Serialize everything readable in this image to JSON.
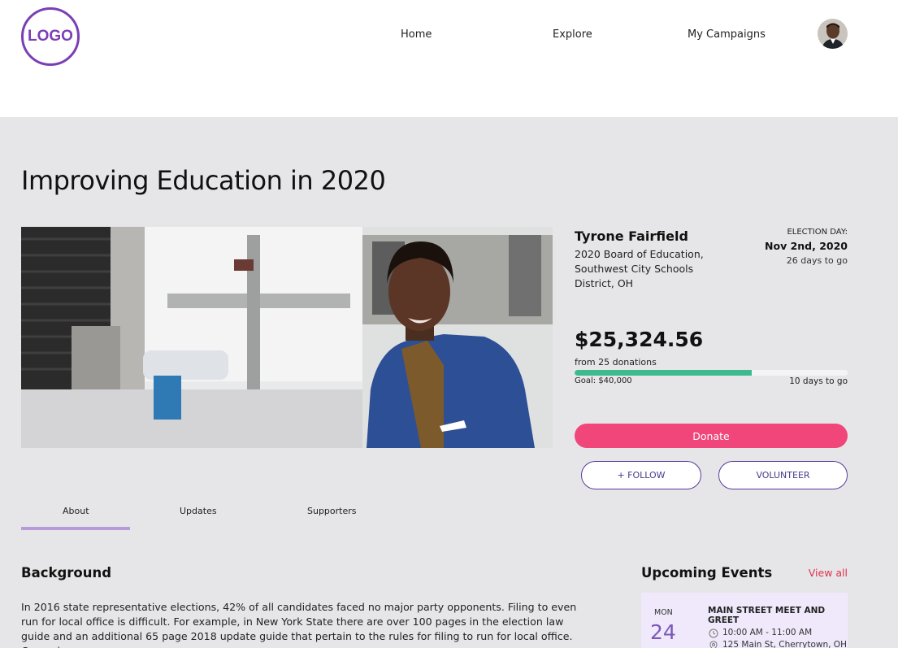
{
  "header": {
    "logo_text": "LOGO",
    "nav": [
      "Home",
      "Explore",
      "My Campaigns"
    ]
  },
  "campaign": {
    "title": "Improving Education in 2020",
    "candidate_name": "Tyrone Fairfield",
    "office": "2020 Board of Education, Southwest City Schools District, OH",
    "election_label": "ELECTION DAY:",
    "election_date": "Nov 2nd, 2020",
    "election_days_left": "26 days to go",
    "amount": "$25,324.56",
    "donations_text": "from 25 donations",
    "progress_fraction": 0.65,
    "goal_text": "Goal: $40,000",
    "goal_days_left": "10 days to go",
    "donate_label": "Donate",
    "follow_label": "+ FOLLOW",
    "volunteer_label": "VOLUNTEER"
  },
  "tabs": [
    "About",
    "Updates",
    "Supporters"
  ],
  "background": {
    "heading": "Background",
    "text": "In 2016 state representative elections, 42% of all candidates faced no major party opponents. Filing to even run for local office is difficult. For example, in New York State there are over 100 pages in the election law guide and an additional 65 page 2018 update guide that pertain to the rules for filing to run for local office. Campaign"
  },
  "events": {
    "heading": "Upcoming Events",
    "view_all": "View all",
    "items": [
      {
        "month": "MON",
        "day": "24",
        "title": "MAIN STREET MEET AND GREET",
        "time": "10:00 AM - 11:00 AM",
        "address": "125 Main St, Cherrytown, OH"
      }
    ]
  },
  "colors": {
    "brand_purple": "#7b3fb5",
    "donate_pink": "#f04679",
    "progress_green": "#3dbb8f",
    "view_all_red": "#e0304f",
    "event_card_bg": "#efe9fb"
  }
}
